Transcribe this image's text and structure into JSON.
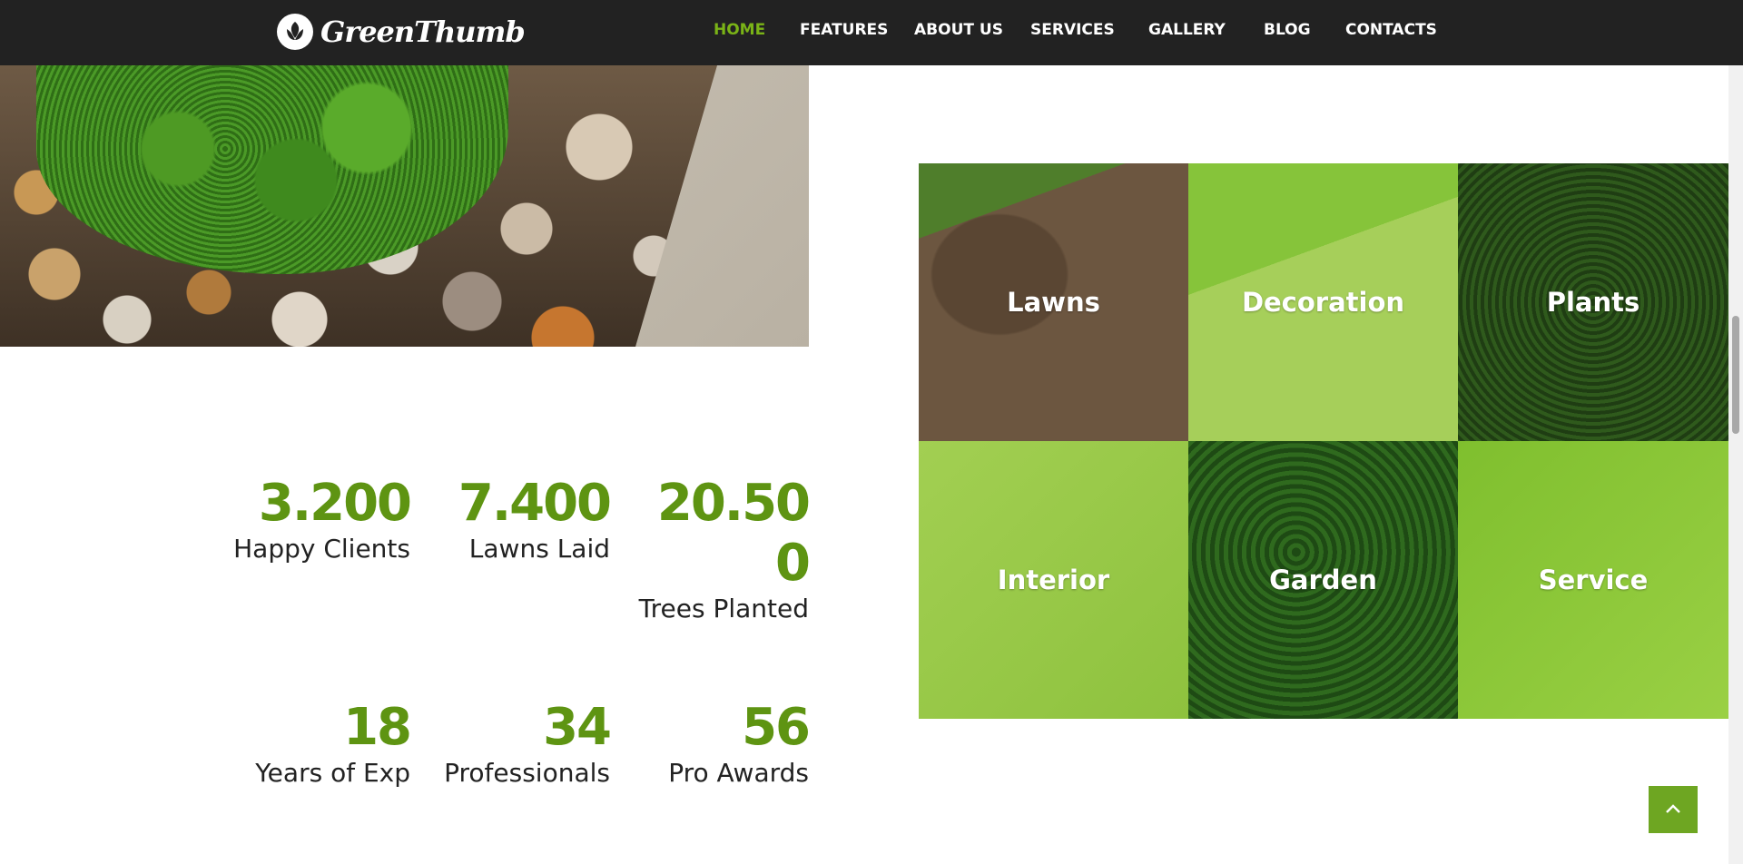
{
  "header": {
    "logo_text": "GreenThumb",
    "nav": [
      {
        "label": "HOME",
        "active": true
      },
      {
        "label": "FEATURES",
        "active": false
      },
      {
        "label": "ABOUT US",
        "active": false
      },
      {
        "label": "SERVICES",
        "active": false
      },
      {
        "label": "GALLERY",
        "active": false
      },
      {
        "label": "BLOG",
        "active": false
      },
      {
        "label": "CONTACTS",
        "active": false
      }
    ]
  },
  "stats": [
    {
      "value": "3.200",
      "label": "Happy Clients"
    },
    {
      "value": "7.400",
      "label": "Lawns Laid"
    },
    {
      "value": "20.500",
      "label": "Trees Planted"
    },
    {
      "value": "18",
      "label": "Years of Exp"
    },
    {
      "value": "34",
      "label": "Professionals"
    },
    {
      "value": "56",
      "label": "Pro Awards"
    }
  ],
  "services": [
    {
      "label": "Lawns"
    },
    {
      "label": "Decoration"
    },
    {
      "label": "Plants"
    },
    {
      "label": "Interior"
    },
    {
      "label": "Garden"
    },
    {
      "label": "Service"
    }
  ],
  "dock": [
    {
      "icon": "cart-icon"
    },
    {
      "icon": "images-icon"
    },
    {
      "icon": "browser-window-icon"
    }
  ],
  "colors": {
    "accent": "#7ab317",
    "stat_value": "#5e9412",
    "header_bg": "#222222"
  }
}
